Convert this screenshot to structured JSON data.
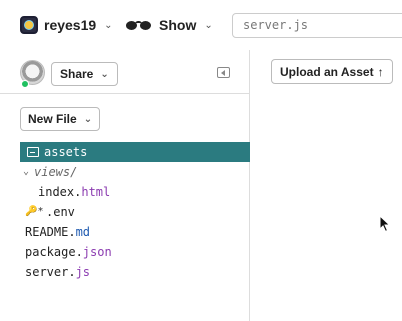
{
  "header": {
    "project_name": "reyes19",
    "project_icon": "project-avatar-icon",
    "show_label": "Show",
    "show_icon": "glasses-icon",
    "search_value": "server.js"
  },
  "sidebar": {
    "share_label": "Share",
    "new_file_label": "New File",
    "files": [
      {
        "name": "assets",
        "type": "folder",
        "selected": true
      },
      {
        "name": "views/",
        "type": "folder-open"
      },
      {
        "base": "index.",
        "ext": "html",
        "indent": true
      },
      {
        "name": ".env",
        "icon": "key-icon"
      },
      {
        "base": "README.",
        "ext": "md"
      },
      {
        "base": "package.",
        "ext": "json"
      },
      {
        "base": "server.",
        "ext": "js"
      }
    ]
  },
  "main": {
    "upload_label": "Upload an Asset",
    "upload_icon": "arrow-up-icon"
  },
  "colors": {
    "selected_bg": "#2b7b80",
    "extension_html_json_js": "#8b3bb0",
    "extension_md": "#1e5ab0",
    "status_online": "#20c060"
  }
}
